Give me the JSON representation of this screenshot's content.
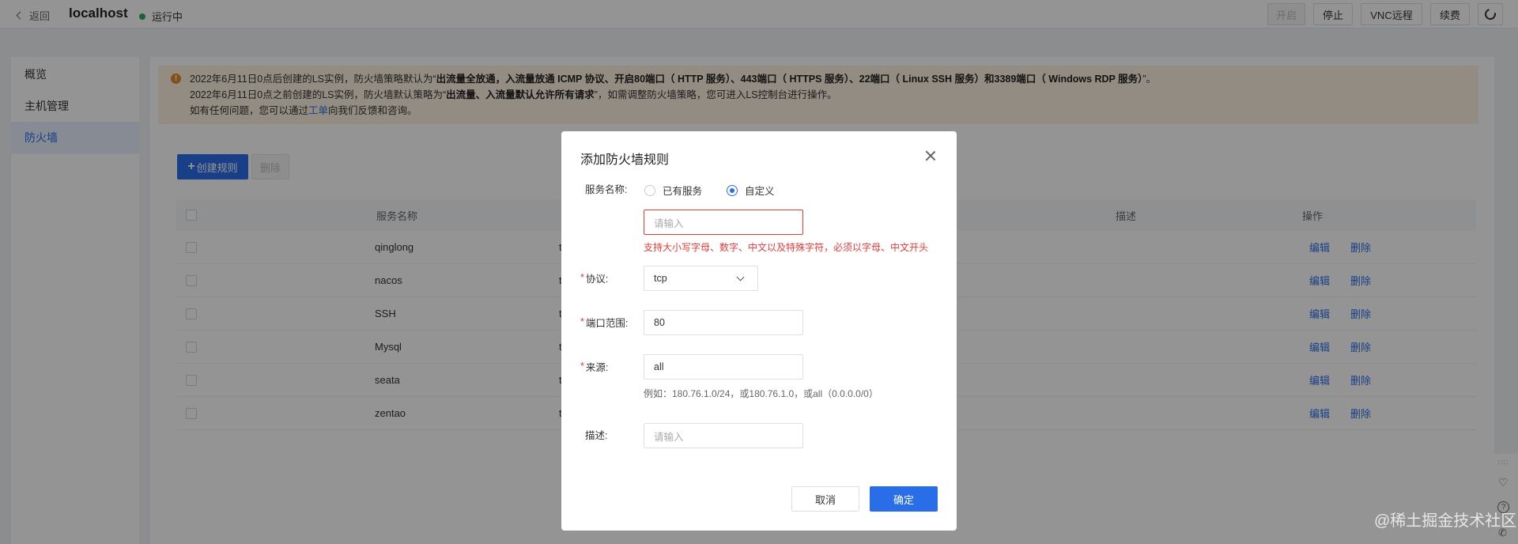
{
  "header": {
    "back_label": "返回",
    "host": "localhost",
    "status": "运行中",
    "buttons": [
      "开启",
      "停止",
      "VNC远程",
      "续费"
    ]
  },
  "sidebar": {
    "items": [
      {
        "label": "概览"
      },
      {
        "label": "主机管理"
      },
      {
        "label": "防火墙"
      }
    ]
  },
  "notice": {
    "line1_pre": "2022年6月11日0点后创建的LS实例，防火墙策略默认为“",
    "line1_bold": "出流量全放通，入流量放通 ICMP 协议、开启80端口（ HTTP 服务）、443端口（ HTTPS 服务）、22端口（ Linux SSH 服务）和3389端口（ Windows RDP 服务）",
    "line1_post": "”。",
    "line2_pre": "2022年6月11日0点之前创建的LS实例，防火墙默认策略为“",
    "line2_bold": "出流量、入流量默认允许所有请求",
    "line2_post": "”，如需调整防火墙策略，您可进入LS控制台进行操作。",
    "line3_pre": "如有任何问题，您可以通过",
    "line3_link": "工单",
    "line3_post": "向我们反馈和咨询。"
  },
  "toolbar": {
    "create_label": "创建规则",
    "delete_label": "删除"
  },
  "table": {
    "columns": {
      "name": "服务名称",
      "desc": "描述",
      "ops": "操作"
    },
    "rows": [
      {
        "name": "qinglong",
        "proto": "t"
      },
      {
        "name": "nacos",
        "proto": "t"
      },
      {
        "name": "SSH",
        "proto": "t"
      },
      {
        "name": "Mysql",
        "proto": "t"
      },
      {
        "name": "seata",
        "proto": "t"
      },
      {
        "name": "zentao",
        "proto": "t"
      }
    ],
    "edit_label": "编辑",
    "delete_label": "删除"
  },
  "modal": {
    "title": "添加防火墙规则",
    "service_label": "服务名称:",
    "radio_existing": "已有服务",
    "radio_custom": "自定义",
    "service_placeholder": "请输入",
    "service_error": "支持大小写字母、数字、中文以及特殊字符，必须以字母、中文开头",
    "protocol_label": "协议:",
    "protocol_value": "tcp",
    "port_label": "端口范围:",
    "port_value": "80",
    "source_label": "来源:",
    "source_value": "all",
    "source_hint": "例如：180.76.1.0/24，或180.76.1.0，或all（0.0.0.0/0）",
    "desc_label": "描述:",
    "desc_placeholder": "请输入",
    "cancel_label": "取消",
    "ok_label": "确定"
  },
  "watermark": "@稀土掘金技术社区",
  "colors": {
    "primary": "#2a6de8",
    "error": "#e23c39",
    "running": "#2eab5f",
    "warning": "#e6892b"
  }
}
